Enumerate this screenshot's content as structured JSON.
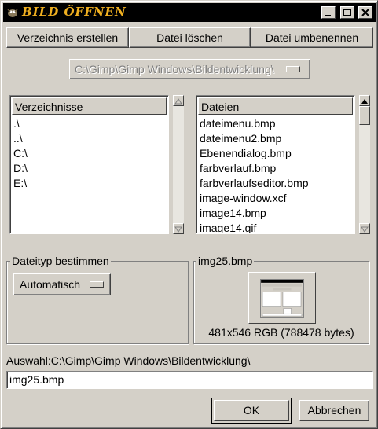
{
  "window": {
    "title": "BILD ÖFFNEN",
    "controls": {
      "minimize": "minimize",
      "maximize": "maximize",
      "close": "close"
    }
  },
  "toolbar": {
    "create_dir": "Verzeichnis erstellen",
    "delete_file": "Datei löschen",
    "rename_file": "Datei umbenennen"
  },
  "path_combo": {
    "value": "C:\\Gimp\\Gimp Windows\\Bildentwicklung\\"
  },
  "directories": {
    "header": "Verzeichnisse",
    "items": [
      ".\\",
      "..\\",
      "C:\\",
      "D:\\",
      "E:\\"
    ]
  },
  "files": {
    "header": "Dateien",
    "items": [
      "dateimenu.bmp",
      "dateimenu2.bmp",
      "Ebenendialog.bmp",
      "farbverlauf.bmp",
      "farbverlaufseditor.bmp",
      "image-window.xcf",
      "image14.bmp",
      "image14.gif"
    ]
  },
  "filetype": {
    "label": "Dateityp bestimmen",
    "value": "Automatisch"
  },
  "preview": {
    "label": "img25.bmp",
    "info": "481x546 RGB (788478 bytes)"
  },
  "selection": {
    "label": "Auswahl:C:\\Gimp\\Gimp Windows\\Bildentwicklung\\",
    "value": "img25.bmp"
  },
  "actions": {
    "ok": "OK",
    "cancel": "Abbrechen"
  },
  "colors": {
    "face": "#d4d0c8",
    "titlebar": "#000000",
    "title_text": "#f0b020"
  }
}
